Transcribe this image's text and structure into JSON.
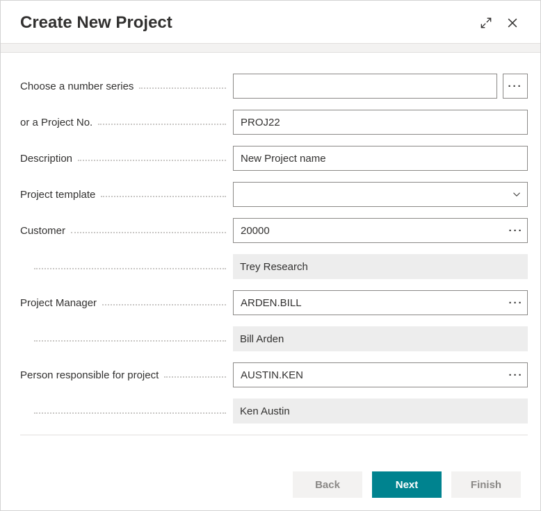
{
  "dialog": {
    "title": "Create New Project"
  },
  "fields": {
    "numberSeries": {
      "label": "Choose a number series",
      "value": ""
    },
    "projectNo": {
      "label": "or a Project No.",
      "value": "PROJ22"
    },
    "description": {
      "label": "Description",
      "value": "New Project name"
    },
    "template": {
      "label": "Project template",
      "value": ""
    },
    "customer": {
      "label": "Customer",
      "value": "20000",
      "display": "Trey Research"
    },
    "manager": {
      "label": "Project Manager",
      "value": "ARDEN.BILL",
      "display": "Bill Arden"
    },
    "responsible": {
      "label": "Person responsible for project",
      "value": "AUSTIN.KEN",
      "display": "Ken Austin"
    }
  },
  "buttons": {
    "back": "Back",
    "next": "Next",
    "finish": "Finish"
  }
}
